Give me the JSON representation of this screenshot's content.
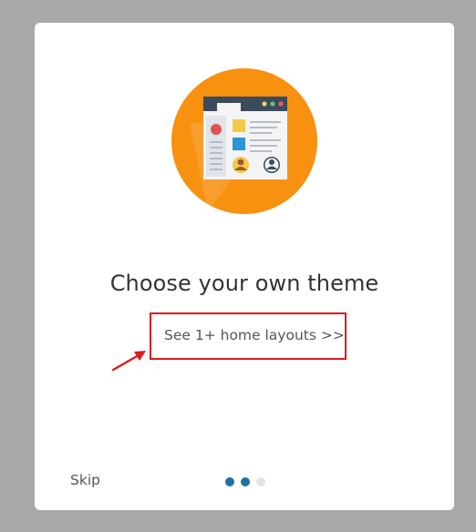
{
  "onboarding": {
    "title": "Choose your own theme",
    "layouts_link": "See 1+ home layouts >>",
    "skip_label": "Skip",
    "page_indicator": {
      "total": 3,
      "active": [
        0,
        1
      ]
    }
  },
  "colors": {
    "accent": "#1f72a6",
    "highlight_box": "#e01b1b",
    "hero_circle": "#f7910f"
  },
  "icons": {
    "hero": "theme-layout-illustration-icon",
    "pointer": "red-arrow-icon"
  }
}
